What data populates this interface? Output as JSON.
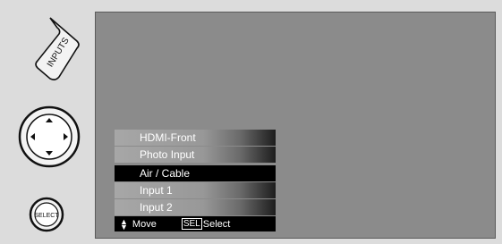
{
  "remote": {
    "inputs_label": "INPUTS",
    "select_label": "SELECT",
    "dpad_icons": [
      "arrow-up-icon",
      "arrow-down-icon",
      "arrow-left-icon",
      "arrow-right-icon"
    ]
  },
  "menu": {
    "group_a": [
      "HDMI-Front",
      "Photo Input"
    ],
    "selected": "Air / Cable",
    "group_b": [
      "Input 1",
      "Input 2"
    ]
  },
  "footer": {
    "move_label": "Move",
    "sel_key": "SEL",
    "select_label": "Select"
  },
  "colors": {
    "background": "#dcdcdc",
    "screen": "#8b8b8b",
    "selected_row": "#000000"
  }
}
